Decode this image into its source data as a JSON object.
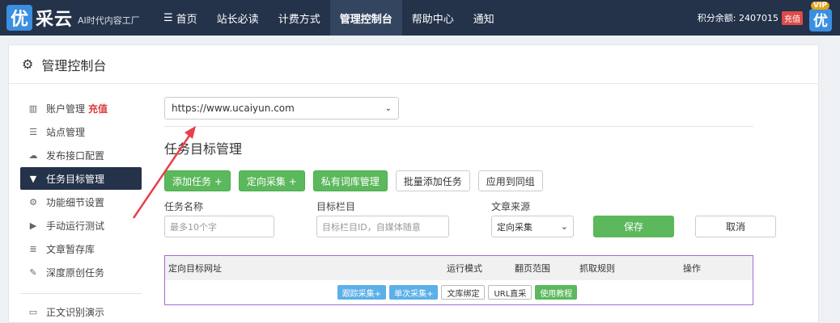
{
  "topbar": {
    "logo_badge": "优",
    "logo_text": "采云",
    "logo_slogan": "AI时代内容工厂",
    "nav": [
      {
        "label": "首页",
        "icon": "☰"
      },
      {
        "label": "站长必读"
      },
      {
        "label": "计费方式"
      },
      {
        "label": "管理控制台",
        "active": true
      },
      {
        "label": "帮助中心"
      },
      {
        "label": "通知"
      }
    ],
    "points_text": "积分余额: 2407015",
    "recharge_label": "充值",
    "vip_label": "VIP",
    "avatar_char": "优"
  },
  "panel": {
    "title": "管理控制台"
  },
  "sidebar": {
    "items": [
      {
        "label": "账户管理",
        "icon": "chart-icon",
        "glyph": "▥",
        "badge": "充值"
      },
      {
        "label": "站点管理",
        "icon": "server-icon",
        "glyph": "☰"
      },
      {
        "label": "发布接口配置",
        "icon": "cloud-upload-icon",
        "glyph": "☁"
      },
      {
        "label": "任务目标管理",
        "icon": "filter-icon",
        "glyph": "▼",
        "active": true
      },
      {
        "label": "功能细节设置",
        "icon": "gears-icon",
        "glyph": "⚙"
      },
      {
        "label": "手动运行测试",
        "icon": "play-icon",
        "glyph": "▶"
      },
      {
        "label": "文章暂存库",
        "icon": "database-icon",
        "glyph": "≣"
      },
      {
        "label": "深度原创任务",
        "icon": "edit-icon",
        "glyph": "✎"
      }
    ],
    "extra_item": {
      "label": "正文识别演示",
      "icon": "monitor-icon",
      "glyph": "▭"
    }
  },
  "main": {
    "url_select_value": "https://www.ucaiyun.com",
    "section_title": "任务目标管理",
    "buttons": [
      {
        "label": "添加任务 +",
        "style": "green"
      },
      {
        "label": "定向采集 +",
        "style": "green"
      },
      {
        "label": "私有词库管理",
        "style": "green"
      },
      {
        "label": "批量添加任务",
        "style": "white"
      },
      {
        "label": "应用到同组",
        "style": "white"
      }
    ],
    "form": {
      "task_name_label": "任务名称",
      "task_name_placeholder": "最多10个字",
      "target_column_label": "目标栏目",
      "target_column_placeholder": "目标栏目ID，自媒体随意",
      "article_source_label": "文章来源",
      "article_source_value": "定向采集",
      "save_label": "保存",
      "cancel_label": "取消"
    },
    "table": {
      "headers": [
        "定向目标网址",
        "运行模式",
        "翻页范围",
        "抓取规则",
        "操作"
      ],
      "actions": [
        {
          "label": "跟踪采集+",
          "style": "blue"
        },
        {
          "label": "单次采集+",
          "style": "blue"
        },
        {
          "label": "文库绑定",
          "style": "white"
        },
        {
          "label": "URL直采",
          "style": "white"
        },
        {
          "label": "使用教程",
          "style": "green"
        }
      ]
    }
  },
  "colors": {
    "nav_bg": "#24324a",
    "green": "#5cb85c",
    "arrow": "#e8404a",
    "table_border": "#a86ad2"
  }
}
